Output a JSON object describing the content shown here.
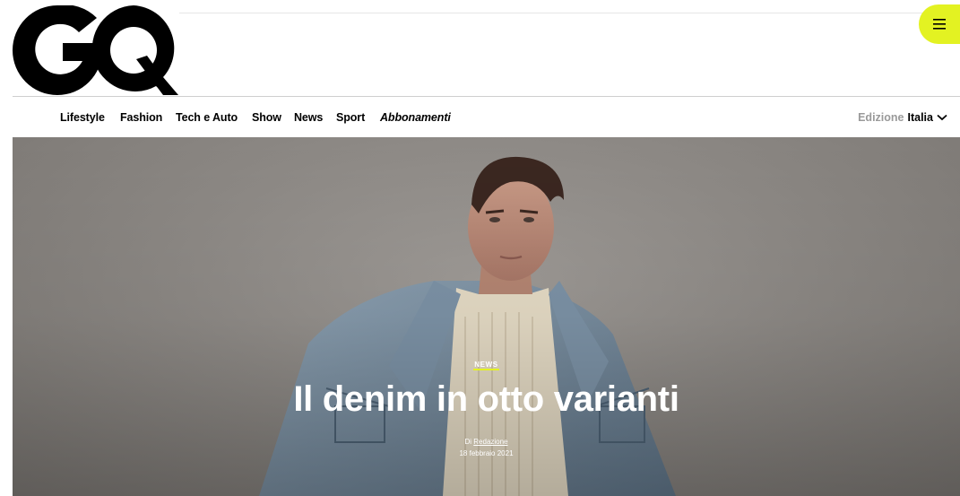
{
  "header": {
    "logo_text": "GQ",
    "menu_icon": "hamburger-menu-icon",
    "accent_color": "#e3f222"
  },
  "nav": {
    "items": [
      {
        "label": "Lifestyle"
      },
      {
        "label": "Fashion"
      },
      {
        "label": "Tech e Auto"
      },
      {
        "label": "Show"
      },
      {
        "label": "News"
      },
      {
        "label": "Sport"
      },
      {
        "label": "Abbonamenti"
      }
    ],
    "edition_label": "Edizione",
    "edition_value": "Italia",
    "edition_icon": "chevron-down-icon"
  },
  "hero": {
    "category": "NEWS",
    "headline": "Il denim in otto varianti",
    "byline_prefix": "Di",
    "author": "Redazione",
    "date": "18 febbraio 2021"
  }
}
